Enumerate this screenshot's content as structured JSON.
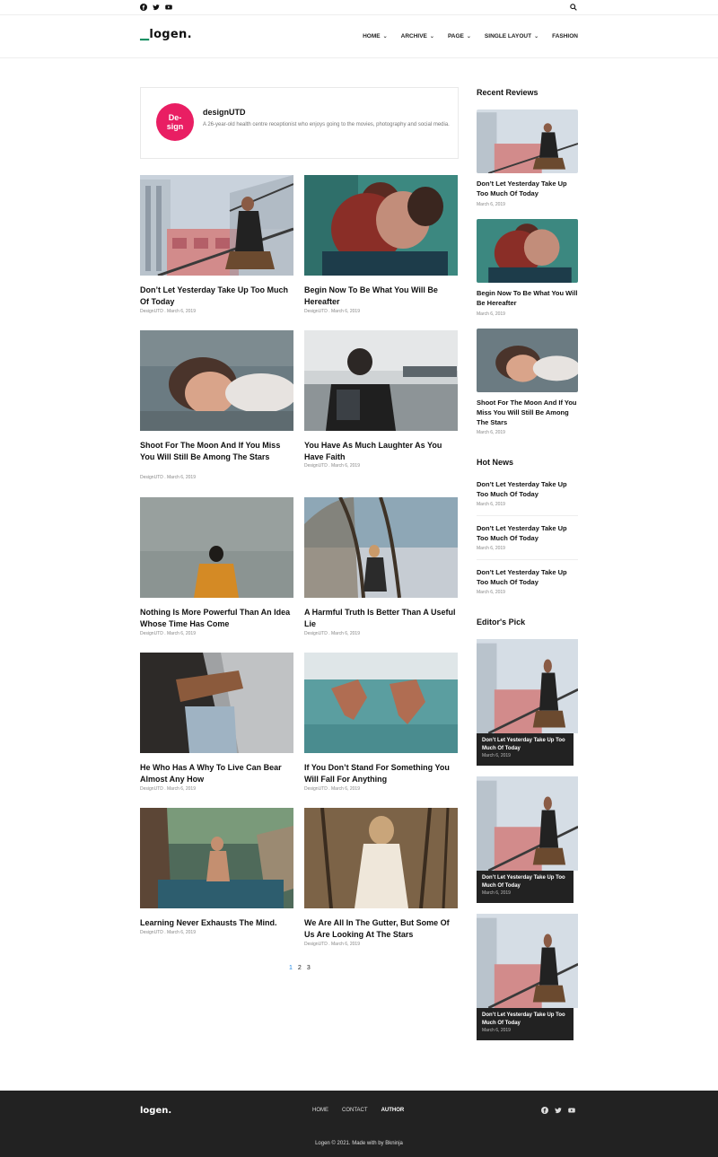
{
  "topbar": {
    "social": [
      "facebook-icon",
      "twitter-icon",
      "youtube-icon"
    ],
    "search_icon": "search-icon"
  },
  "header": {
    "logo": "logen.",
    "nav": [
      {
        "label": "HOME",
        "dropdown": true
      },
      {
        "label": "ARCHIVE",
        "dropdown": true
      },
      {
        "label": "PAGE",
        "dropdown": true
      },
      {
        "label": "SINGLE LAYOUT",
        "dropdown": true
      },
      {
        "label": "FASHION",
        "dropdown": false
      }
    ]
  },
  "author": {
    "avatar_text": "De-\nsign",
    "name": "designUTD",
    "bio": "A 26-year-old health centre receptionist who enjoys going to the movies, photography and social media."
  },
  "posts": [
    {
      "title": "Don’t Let Yesterday Take Up Too Much Of Today",
      "meta": "DesignUTD . March 6, 2019"
    },
    {
      "title": "Begin Now To Be What You Will Be Hereafter",
      "meta": "DesignUTD . March 6, 2019"
    },
    {
      "title": "Shoot For The Moon And If You Miss You Will Still Be Among The Stars",
      "meta": "DesignUTD . March 6, 2019"
    },
    {
      "title": "You Have As Much Laughter As You Have Faith",
      "meta": "DesignUTD . March 6, 2019"
    },
    {
      "title": "Nothing Is More Powerful Than An Idea Whose Time Has Come",
      "meta": "DesignUTD . March 6, 2019"
    },
    {
      "title": "A Harmful Truth Is Better Than A Useful Lie",
      "meta": "DesignUTD . March 6, 2019"
    },
    {
      "title": "He Who Has A Why To Live Can Bear Almost Any How",
      "meta": "DesignUTD . March 6, 2019"
    },
    {
      "title": "If You Don’t Stand For Something You Will Fall For Anything",
      "meta": "DesignUTD . March 6, 2019"
    },
    {
      "title": "Learning Never Exhausts The Mind.",
      "meta": "DesignUTD . March 6, 2019"
    },
    {
      "title": "We Are All In The Gutter, But Some Of Us Are Looking At The Stars",
      "meta": "DesignUTD . March 6, 2019"
    }
  ],
  "pagination": {
    "pages": [
      "1",
      "2",
      "3"
    ],
    "current": "1"
  },
  "sidebar": {
    "recent_reviews": {
      "title": "Recent Reviews",
      "items": [
        {
          "title": "Don’t Let Yesterday Take Up Too Much Of Today",
          "date": "March 6, 2019"
        },
        {
          "title": "Begin Now To Be What You Will Be Hereafter",
          "date": "March 6, 2019"
        },
        {
          "title": "Shoot For The Moon And If You Miss You Will Still Be Among The Stars",
          "date": "March 6, 2019"
        }
      ]
    },
    "hot_news": {
      "title": "Hot News",
      "items": [
        {
          "title": "Don’t Let Yesterday Take Up Too Much Of Today",
          "date": "March 6, 2019"
        },
        {
          "title": "Don’t Let Yesterday Take Up Too Much Of Today",
          "date": "March 6, 2019"
        },
        {
          "title": "Don’t Let Yesterday Take Up Too Much Of Today",
          "date": "March 6, 2019"
        }
      ]
    },
    "editors_pick": {
      "title": "Editor's Pick",
      "items": [
        {
          "title": "Don’t Let Yesterday Take Up Too Much Of Today",
          "date": "March 6, 2019"
        },
        {
          "title": "Don’t Let Yesterday Take Up Too Much Of Today",
          "date": "March 6, 2019"
        },
        {
          "title": "Don’t Let Yesterday Take Up Too Much Of Today",
          "date": "March 6, 2019"
        }
      ]
    }
  },
  "footer": {
    "logo": "logen.",
    "nav": [
      {
        "label": "HOME",
        "active": false
      },
      {
        "label": "CONTACT",
        "active": false
      },
      {
        "label": "AUTHOR",
        "active": true
      }
    ],
    "social": [
      "facebook-icon",
      "twitter-icon",
      "youtube-icon"
    ],
    "copyright": "Logen © 2021. Made with by Bkninja"
  },
  "colors": {
    "accent": "#e91e63",
    "brand_green": "#0c8a5b",
    "link_active": "#1e88e5",
    "footer_bg": "#222222"
  }
}
